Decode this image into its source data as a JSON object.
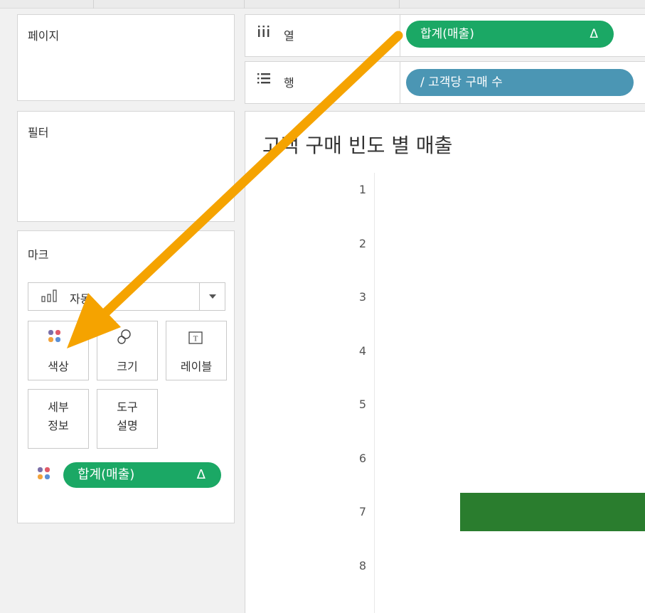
{
  "pages_card": {
    "title": "페이지"
  },
  "filters_card": {
    "title": "필터"
  },
  "marks_card": {
    "title": "마크",
    "mark_type": {
      "icon": "bar-chart-icon",
      "value": "자동"
    },
    "buttons": [
      {
        "label": "색상",
        "icon": "color-dots-icon"
      },
      {
        "label": "크기",
        "icon": "size-icon"
      },
      {
        "label": "레이블",
        "icon": "text-label-icon"
      },
      {
        "label": "세부\n정보",
        "line1": "세부",
        "line2": "정보"
      },
      {
        "label": "도구\n설명",
        "line1": "도구",
        "line2": "설명"
      }
    ],
    "color_field": {
      "label": "합계(매출)",
      "delta": "Δ"
    }
  },
  "columns_shelf": {
    "icon": "columns-icon",
    "label": "열",
    "pill": {
      "label": "합계(매출)",
      "delta": "Δ"
    }
  },
  "rows_shelf": {
    "icon": "rows-icon",
    "label": "행",
    "pill": {
      "label": "/ 고객당 구매 수"
    }
  },
  "view": {
    "title": "고객 구매 빈도 별 매출"
  },
  "chart_data": {
    "type": "bar",
    "orientation": "horizontal",
    "title": "고객 구매 빈도 별 매출",
    "categories": [
      "1",
      "2",
      "3",
      "4",
      "5",
      "6",
      "7",
      "8"
    ],
    "values": [
      null,
      null,
      null,
      null,
      null,
      null,
      1,
      null
    ],
    "bar_color": "#2a7d2e"
  },
  "colors": {
    "accent_green": "#1ba865",
    "accent_blue": "#4b96b4",
    "arrow": "#f5a300"
  }
}
